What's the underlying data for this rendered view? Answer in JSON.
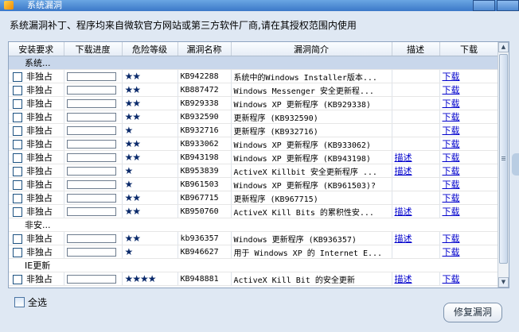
{
  "window": {
    "title": "系统漏洞"
  },
  "notice": "系统漏洞补丁、程序均来自微软官方网站或第三方软件厂商,请在其授权范围内使用",
  "columns": [
    "安装要求",
    "下载进度",
    "危险等级",
    "漏洞名称",
    "漏洞简介",
    "描述",
    "下载"
  ],
  "rows": [
    {
      "type": "group",
      "label": "系统..."
    },
    {
      "type": "item",
      "req": "非独占",
      "stars": "★★",
      "kb": "KB942288",
      "desc": "系统中的Windows Installer版本...",
      "link": "",
      "dl": "下载"
    },
    {
      "type": "item",
      "req": "非独占",
      "stars": "★★",
      "kb": "KB887472",
      "desc": "Windows Messenger 安全更新程...",
      "link": "",
      "dl": "下载"
    },
    {
      "type": "item",
      "req": "非独占",
      "stars": "★★",
      "kb": "KB929338",
      "desc": "Windows XP 更新程序 (KB929338)",
      "link": "",
      "dl": "下载"
    },
    {
      "type": "item",
      "req": "非独占",
      "stars": "★★",
      "kb": "KB932590",
      "desc": "更新程序 (KB932590)",
      "link": "",
      "dl": "下载"
    },
    {
      "type": "item",
      "req": "非独占",
      "stars": "★",
      "kb": "KB932716",
      "desc": "更新程序 (KB932716)",
      "link": "",
      "dl": "下载"
    },
    {
      "type": "item",
      "req": "非独占",
      "stars": "★★",
      "kb": "KB933062",
      "desc": "Windows XP 更新程序 (KB933062)",
      "link": "",
      "dl": "下载"
    },
    {
      "type": "item",
      "req": "非独占",
      "stars": "★★",
      "kb": "KB943198",
      "desc": "Windows XP 更新程序 (KB943198)",
      "link": "描述",
      "dl": "下载"
    },
    {
      "type": "item",
      "req": "非独占",
      "stars": "★",
      "kb": "KB953839",
      "desc": "ActiveX Killbit 安全更新程序 ...",
      "link": "描述",
      "dl": "下载"
    },
    {
      "type": "item",
      "req": "非独占",
      "stars": "★",
      "kb": "KB961503",
      "desc": "Windows XP 更新程序 (KB961503)?",
      "link": "",
      "dl": "下载"
    },
    {
      "type": "item",
      "req": "非独占",
      "stars": "★★",
      "kb": "KB967715",
      "desc": "更新程序 (KB967715)",
      "link": "",
      "dl": "下载"
    },
    {
      "type": "item",
      "req": "非独占",
      "stars": "★★",
      "kb": "KB950760",
      "desc": "ActiveX Kill Bits 的累积性安...",
      "link": "描述",
      "dl": "下载"
    },
    {
      "type": "group",
      "label": "非安..."
    },
    {
      "type": "item",
      "req": "非独占",
      "stars": "★★",
      "kb": "kb936357",
      "desc": "Windows 更新程序 (KB936357)",
      "link": "描述",
      "dl": "下载"
    },
    {
      "type": "item",
      "req": "非独占",
      "stars": "★",
      "kb": "KB946627",
      "desc": "用于 Windows XP 的 Internet E...",
      "link": "",
      "dl": "下载"
    },
    {
      "type": "group",
      "label": "IE更新"
    },
    {
      "type": "item",
      "req": "非独占",
      "stars": "★★★★",
      "kb": "KB948881",
      "desc": "ActiveX Kill Bit 的安全更新",
      "link": "描述",
      "dl": "下载"
    }
  ],
  "select_all_label": "全选",
  "fix_button": "修复漏洞",
  "colors": {
    "star": "#0a2a6b",
    "link": "#0000cc",
    "group_highlight": "#c9d7eb",
    "titlebar": "#3b78c8"
  }
}
